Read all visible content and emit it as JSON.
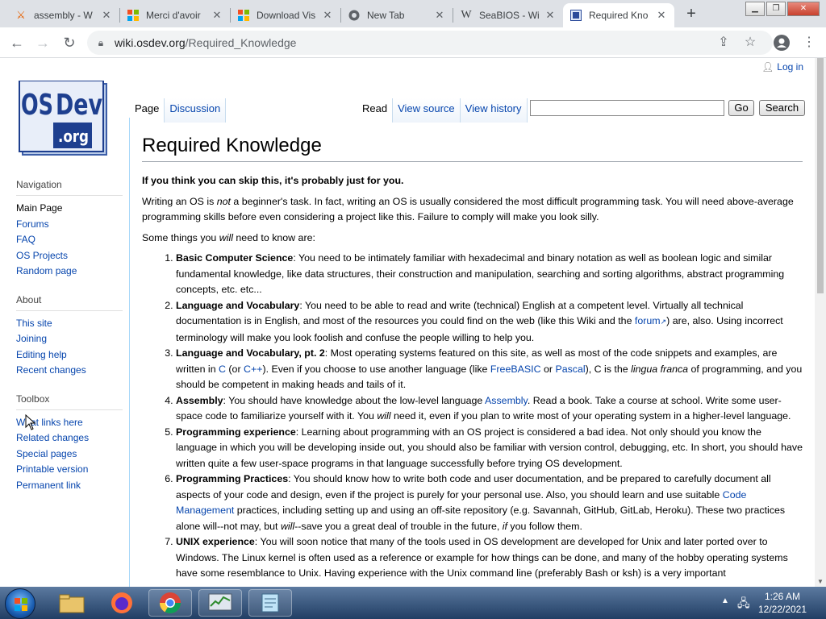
{
  "browser": {
    "tabs": [
      {
        "title": "assembly - W",
        "icon": "firefox-like-icon"
      },
      {
        "title": "Merci d'avoir",
        "icon": "microsoft-icon"
      },
      {
        "title": "Download Vis",
        "icon": "microsoft-icon"
      },
      {
        "title": "New Tab",
        "icon": "chrome-icon"
      },
      {
        "title": "SeaBIOS - Wi",
        "icon": "wikipedia-icon"
      },
      {
        "title": "Required Kno",
        "icon": "osdev-icon"
      }
    ],
    "url_host": "wiki.osdev.org",
    "url_path": "/Required_Knowledge"
  },
  "wiki": {
    "login": "Log in",
    "logo": {
      "line1": "OS",
      "line2": "Dev",
      "line3": ".org"
    },
    "tabs_left": [
      "Page",
      "Discussion"
    ],
    "tabs_right": [
      "Read",
      "View source",
      "View history"
    ],
    "search": {
      "go": "Go",
      "search": "Search"
    },
    "sidebar": {
      "navigation": {
        "title": "Navigation",
        "items": [
          "Main Page",
          "Forums",
          "FAQ",
          "OS Projects",
          "Random page"
        ]
      },
      "about": {
        "title": "About",
        "items": [
          "This site",
          "Joining",
          "Editing help",
          "Recent changes"
        ]
      },
      "toolbox": {
        "title": "Toolbox",
        "items": [
          "What links here",
          "Related changes",
          "Special pages",
          "Printable version",
          "Permanent link"
        ]
      }
    },
    "article": {
      "title": "Required Knowledge",
      "lead_bold": "If you think you can skip this, it's probably just for you.",
      "intro_1": "Writing an OS is ",
      "intro_not": "not",
      "intro_2": " a beginner's task. In fact, writing an OS is usually considered the most difficult programming task. You will need above-average programming skills before even considering a project like this. Failure to comply will make you look silly.",
      "some_1": "Some things you ",
      "some_will": "will",
      "some_2": " need to know are:",
      "items": [
        {
          "head": "Basic Computer Science",
          "text": ": You need to be intimately familiar with hexadecimal and binary notation as well as boolean logic and similar fundamental knowledge, like data structures, their construction and manipulation, searching and sorting algorithms, abstract programming concepts, etc. etc..."
        },
        {
          "head": "Language and Vocabulary",
          "t1": ": You need to be able to read and write (technical) English at a competent level. Virtually all technical documentation is in English, and most of the resources you could find on the web (like this Wiki and the ",
          "link": "forum",
          "t2": ") are, also. Using incorrect terminology will make you look foolish and confuse the people willing to help you."
        },
        {
          "head": "Language and Vocabulary, pt. 2",
          "t1": ": Most operating systems featured on this site, as well as most of the code snippets and examples, are written in ",
          "l1": "C",
          "t2": " (or ",
          "l2": "C++",
          "t3": "). Even if you choose to use another language (like ",
          "l3": "FreeBASIC",
          "t4": " or ",
          "l4": "Pascal",
          "t5": "), C is the ",
          "i1": "lingua franca",
          "t6": " of programming, and you should be competent in making heads and tails of it."
        },
        {
          "head": "Assembly",
          "t1": ": You should have knowledge about the low-level language ",
          "l1": "Assembly",
          "t2": ". Read a book. Take a course at school. Write some user-space code to familiarize yourself with it. You ",
          "i1": "will",
          "t3": " need it, even if you plan to write most of your operating system in a higher-level language."
        },
        {
          "head": "Programming experience",
          "text": ": Learning about programming with an OS project is considered a bad idea. Not only should you know the language in which you will be developing inside out, you should also be familiar with version control, debugging, etc. In short, you should have written quite a few user-space programs in that language successfully before trying OS development."
        },
        {
          "head": "Programming Practices",
          "t1": ": You should know how to write both code and user documentation, and be prepared to carefully document all aspects of your code and design, even if the project is purely for your personal use. Also, you should learn and use suitable ",
          "l1": "Code Management",
          "t2": " practices, including setting up and using an off-site repository (e.g. Savannah, GitHub, GitLab, Heroku). These two practices alone will--not may, but ",
          "i1": "will",
          "t3": "--save you a great deal of trouble in the future, ",
          "i2": "if",
          "t4": " you follow them."
        },
        {
          "head": "UNIX experience",
          "text": ": You will soon notice that many of the tools used in OS development are developed for Unix and later ported over to Windows. The Linux kernel is often used as a reference or example for how things can be done, and many of the hobby operating systems have some resemblance to Unix. Having experience with the Unix command line (preferably Bash or ksh) is a very important"
        }
      ]
    }
  },
  "taskbar": {
    "time": "1:26 AM",
    "date": "12/22/2021"
  }
}
